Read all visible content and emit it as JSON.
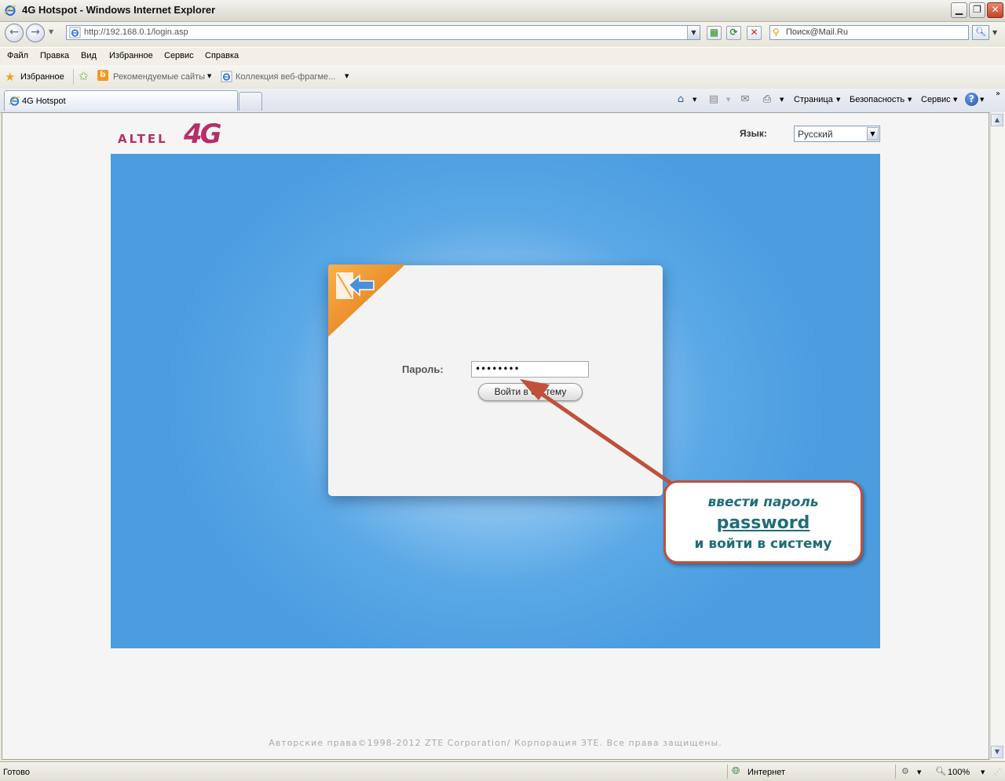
{
  "window": {
    "title": "4G Hotspot - Windows Internet Explorer"
  },
  "address_bar": {
    "url": "http://192.168.0.1/login.asp"
  },
  "search": {
    "placeholder": "Поиск@Mail.Ru"
  },
  "menu": {
    "items": [
      "Файл",
      "Правка",
      "Вид",
      "Избранное",
      "Сервис",
      "Справка"
    ]
  },
  "favorites_bar": {
    "favorites_label": "Избранное",
    "suggested_sites": "Рекомендуемые сайты",
    "web_slice_gallery": "Коллекция веб-фрагме..."
  },
  "tabs": {
    "active_label": "4G Hotspot"
  },
  "command_bar": {
    "page_label": "Страница",
    "safety_label": "Безопасность",
    "tools_label": "Сервис"
  },
  "page": {
    "logo_text": "ALTEL",
    "logo_mark": "4G",
    "language_label": "Язык:",
    "language_value": "Русский",
    "password_label": "Пароль:",
    "password_value": "••••••••",
    "login_button": "Войти в систему",
    "copyright": "Авторские права©1998-2012 ZTE Corporation/ Корпорация ЗТЕ. Все права защищены."
  },
  "annotation": {
    "line1": "ввести пароль",
    "line2": "password",
    "line3": "и войти в систему",
    "color": "#c0503a",
    "text_color": "#1f6d78"
  },
  "status_bar": {
    "status": "Готово",
    "zone": "Интернет",
    "zoom": "100%"
  },
  "colors": {
    "brand": "#b3306a",
    "panel_blue": "#4b9de0",
    "badge_orange": "#f08a1c"
  }
}
